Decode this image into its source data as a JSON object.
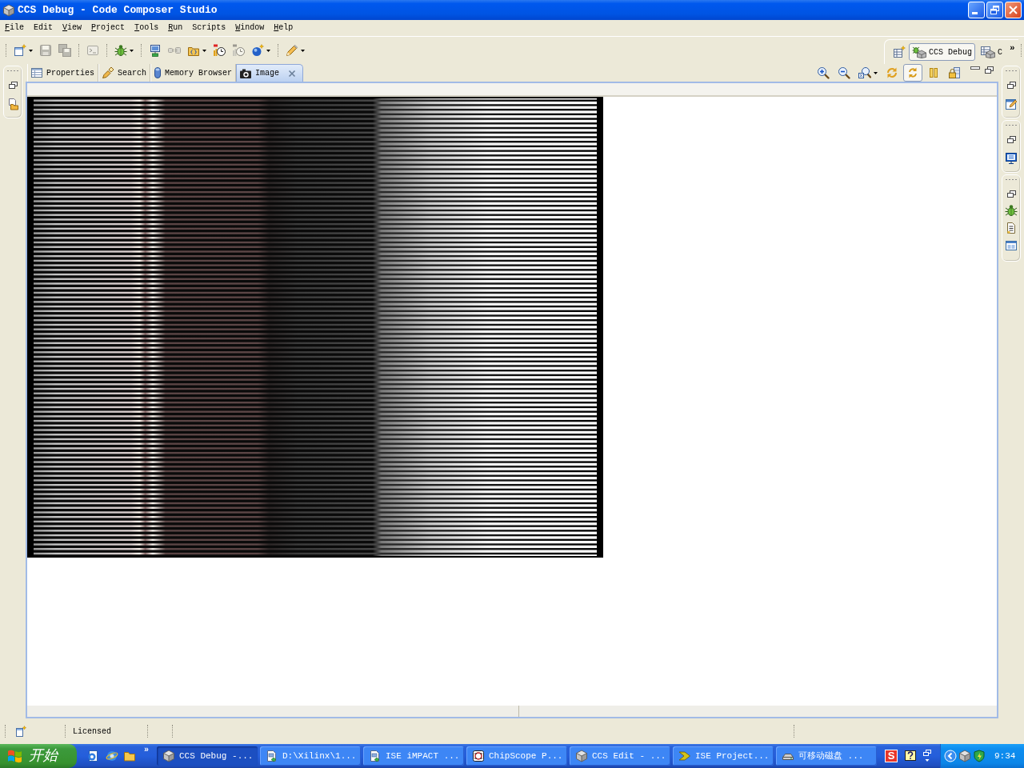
{
  "window": {
    "title": "CCS Debug - Code Composer Studio"
  },
  "menu_bar": [
    {
      "label": "File",
      "mnemonic": true
    },
    {
      "label": "Edit",
      "mnemonic": false
    },
    {
      "label": "View",
      "mnemonic": true
    },
    {
      "label": "Project",
      "mnemonic": true
    },
    {
      "label": "Tools",
      "mnemonic": true
    },
    {
      "label": "Run",
      "mnemonic": true
    },
    {
      "label": "Scripts",
      "mnemonic": false
    },
    {
      "label": "Window",
      "mnemonic": true
    },
    {
      "label": "Help",
      "mnemonic": true
    }
  ],
  "toolbar": {
    "groups": [
      {
        "items": [
          {
            "kind": "new",
            "disabled": false,
            "dropdown": true
          },
          {
            "kind": "save",
            "disabled": true,
            "dropdown": false
          },
          {
            "kind": "save-all",
            "disabled": true,
            "dropdown": false
          }
        ]
      },
      {
        "items": [
          {
            "kind": "terminal",
            "disabled": true,
            "dropdown": false
          }
        ]
      },
      {
        "items": [
          {
            "kind": "debug",
            "disabled": false,
            "dropdown": true
          }
        ]
      },
      {
        "items": [
          {
            "kind": "target",
            "disabled": false,
            "dropdown": false
          },
          {
            "kind": "plug",
            "disabled": true,
            "dropdown": false
          },
          {
            "kind": "load",
            "disabled": false,
            "dropdown": true
          },
          {
            "kind": "clock",
            "disabled": false,
            "dropdown": false
          },
          {
            "kind": "clock",
            "disabled": true,
            "dropdown": false
          },
          {
            "kind": "sphere",
            "disabled": false,
            "dropdown": true
          }
        ]
      },
      {
        "items": [
          {
            "kind": "pencil",
            "disabled": false,
            "dropdown": true
          }
        ]
      }
    ]
  },
  "perspectives": {
    "items": [
      {
        "kind": "debug",
        "label": "CCS Debug",
        "selected": true
      },
      {
        "kind": "edit",
        "label": "C",
        "selected": false
      }
    ],
    "overflow": "»"
  },
  "view": {
    "tabs": [
      {
        "kind": "table",
        "label": "Properties",
        "selected": false
      },
      {
        "kind": "search",
        "label": "Search",
        "selected": false
      },
      {
        "kind": "memory",
        "label": "Memory Browser",
        "selected": false
      },
      {
        "kind": "camera",
        "label": "Image",
        "selected": true
      }
    ],
    "toolbar": [
      {
        "kind": "zoom-in",
        "pressed": false,
        "dropdown": false
      },
      {
        "kind": "zoom-out",
        "pressed": false,
        "dropdown": false
      },
      {
        "kind": "zoom-fit",
        "pressed": false,
        "dropdown": true
      },
      {
        "kind": "refresh",
        "pressed": false,
        "dropdown": false
      },
      {
        "kind": "sync",
        "pressed": true,
        "dropdown": false
      },
      {
        "kind": "columns",
        "pressed": false,
        "dropdown": false
      },
      {
        "kind": "lock",
        "pressed": false,
        "dropdown": false
      }
    ]
  },
  "status_bar": {
    "text": "Licensed"
  },
  "taskbar": {
    "start_label": "开始",
    "quick_launch_more": "»",
    "tasks": [
      {
        "kind": "cube",
        "label": "CCS Debug -...",
        "selected": true
      },
      {
        "kind": "document",
        "label": "D:\\Xilinx\\1...",
        "selected": false
      },
      {
        "kind": "document",
        "label": "ISE iMPACT ...",
        "selected": false
      },
      {
        "kind": "chip",
        "label": "ChipScope P...",
        "selected": false
      },
      {
        "kind": "cube",
        "label": "CCS Edit - ...",
        "selected": false
      },
      {
        "kind": "chevron",
        "label": "ISE Project...",
        "selected": false
      },
      {
        "kind": "drive",
        "label": "可移动磁盘 ...",
        "selected": false
      }
    ],
    "tray_logo": "S",
    "clock": "9:34"
  }
}
